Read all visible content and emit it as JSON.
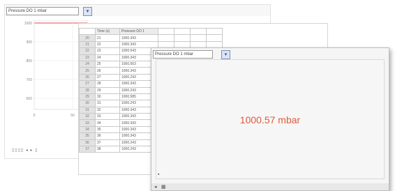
{
  "chart_window": {
    "selector": "Pressure DO 1 mbar",
    "dropdown_icon": "chevron-down-icon",
    "footer": "▯▯▯▯ ◂ ▸ ▯",
    "y_ticks": [
      "1000",
      "900",
      "800",
      "700",
      "600"
    ],
    "x_ticks": [
      "0",
      "50"
    ],
    "line_color": "#e34a4a"
  },
  "table_window": {
    "headers": [
      "Time (s)",
      "Pressure DO 1"
    ],
    "rows": [
      {
        "row": "20",
        "time": "21",
        "value": "1000.343"
      },
      {
        "row": "21",
        "time": "22",
        "value": "1000.343"
      },
      {
        "row": "22",
        "time": "23",
        "value": "1000.543"
      },
      {
        "row": "23",
        "time": "24",
        "value": "1000.343"
      },
      {
        "row": "24",
        "time": "25",
        "value": "1000.563"
      },
      {
        "row": "25",
        "time": "26",
        "value": "1000.343"
      },
      {
        "row": "26",
        "time": "27",
        "value": "1000.243"
      },
      {
        "row": "27",
        "time": "28",
        "value": "1000.343"
      },
      {
        "row": "28",
        "time": "29",
        "value": "1000.243"
      },
      {
        "row": "29",
        "time": "30",
        "value": "1000.585"
      },
      {
        "row": "30",
        "time": "31",
        "value": "1000.243"
      },
      {
        "row": "31",
        "time": "32",
        "value": "1000.343"
      },
      {
        "row": "32",
        "time": "33",
        "value": "1000.343"
      },
      {
        "row": "33",
        "time": "34",
        "value": "1000.343"
      },
      {
        "row": "34",
        "time": "35",
        "value": "1000.343"
      },
      {
        "row": "35",
        "time": "36",
        "value": "1000.343"
      },
      {
        "row": "36",
        "time": "37",
        "value": "1000.243"
      },
      {
        "row": "37",
        "time": "38",
        "value": "1000.243"
      }
    ]
  },
  "value_window": {
    "selector": "Pressure DO 1 mbar",
    "dropdown_icon": "chevron-down-icon",
    "reading": "1000.57 mbar",
    "reading_color": "#e05a3c",
    "footer_icons": [
      "arrow-left-icon",
      "grid-icon"
    ]
  }
}
